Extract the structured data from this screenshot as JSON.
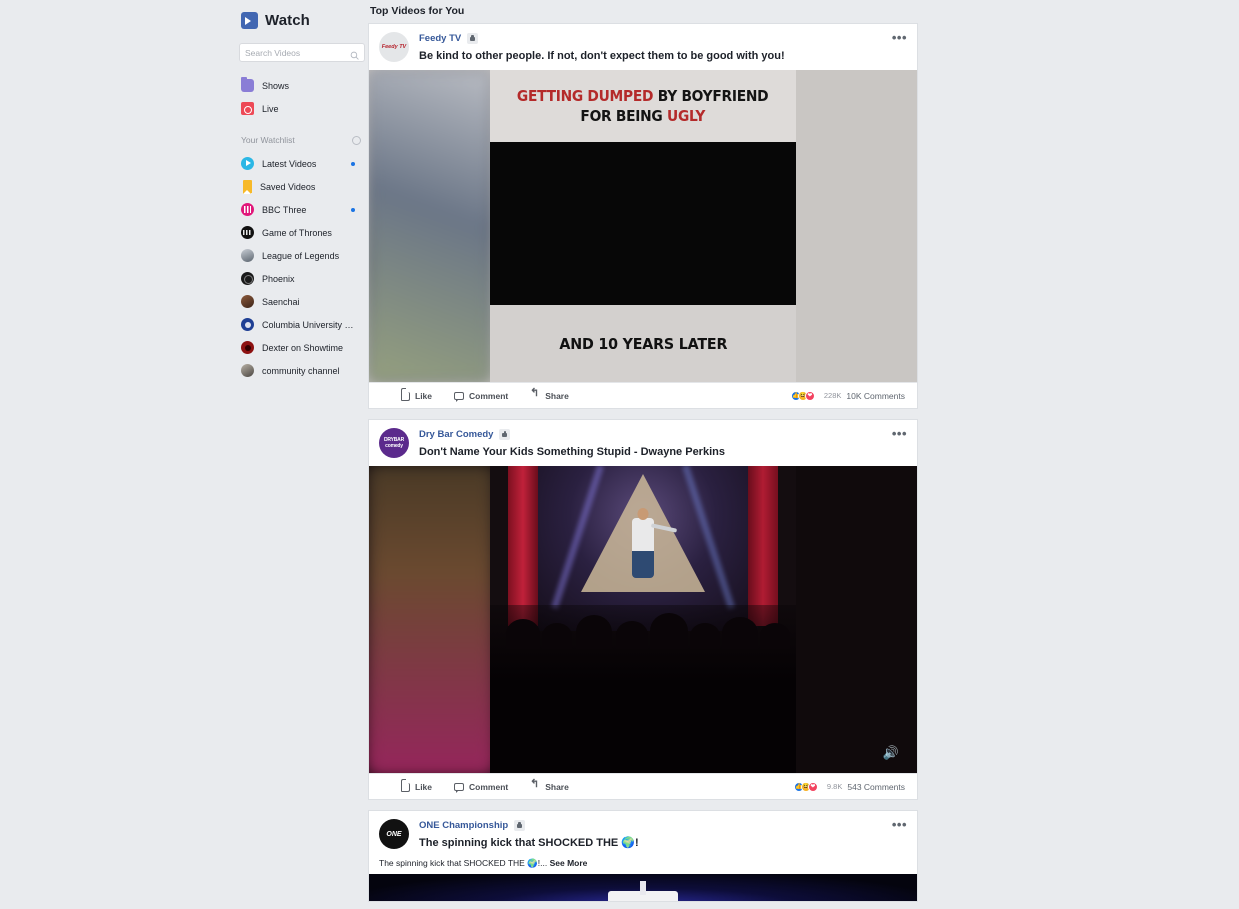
{
  "app": {
    "title": "Watch",
    "brand_icon": "watch-video-icon",
    "background": "#e9ebee"
  },
  "search": {
    "placeholder": "Search Videos",
    "value": "",
    "icon": "search-icon"
  },
  "sidebar": {
    "primary": [
      {
        "label": "Shows",
        "icon": "shows-icon"
      },
      {
        "label": "Live",
        "icon": "live-icon"
      }
    ],
    "watchlist_header": {
      "label": "Your Watchlist",
      "icon": "gear-icon"
    },
    "watchlist": [
      {
        "label": "Latest Videos",
        "icon": "latest-videos-icon",
        "unread": true
      },
      {
        "label": "Saved Videos",
        "icon": "bookmark-icon",
        "unread": false
      },
      {
        "label": "BBC Three",
        "icon": "bbc-three-avatar",
        "unread": true
      },
      {
        "label": "Game of Thrones",
        "icon": "game-of-thrones-avatar",
        "unread": false
      },
      {
        "label": "League of Legends",
        "icon": "league-of-legends-avatar",
        "unread": false
      },
      {
        "label": "Phoenix",
        "icon": "phoenix-avatar",
        "unread": false
      },
      {
        "label": "Saenchai",
        "icon": "saenchai-avatar",
        "unread": false
      },
      {
        "label": "Columbia University in ...",
        "icon": "columbia-university-avatar",
        "unread": false
      },
      {
        "label": "Dexter on Showtime",
        "icon": "dexter-avatar",
        "unread": false
      },
      {
        "label": "community channel",
        "icon": "community-channel-avatar",
        "unread": false
      }
    ]
  },
  "feed": {
    "heading": "Top Videos for You",
    "action_labels": {
      "like": "Like",
      "comment": "Comment",
      "share": "Share"
    },
    "posts": [
      {
        "page_name": "Feedy TV",
        "avatar_text": "Feedy TV",
        "badge": "video-badge-icon",
        "title": "Be kind to other people. If not, don't expect them to be good with you!",
        "subtitle": "",
        "see_more": "",
        "thumbnail": {
          "headline_line1_red": "GETTING DUMPED",
          "headline_line1_rest": " BY BOYFRIEND",
          "headline_line2_pre": "FOR BEING ",
          "headline_line2_red": "UGLY",
          "caption_bottom": "AND 10 YEARS LATER"
        },
        "reactions_count": "228K",
        "comments_count": "10K Comments",
        "menu": "more-options-icon"
      },
      {
        "page_name": "Dry Bar Comedy",
        "avatar_text": "DRYBAR comedy",
        "badge": "video-badge-icon",
        "title": "Don't Name Your Kids Something Stupid - Dwayne Perkins",
        "subtitle": "",
        "see_more": "",
        "thumbnail": {
          "muted_icon": "speaker-muted-icon"
        },
        "reactions_count": "9.8K",
        "comments_count": "543 Comments",
        "menu": "more-options-icon"
      },
      {
        "page_name": "ONE Championship",
        "avatar_text": "ONE",
        "badge": "video-badge-icon",
        "title": "The spinning kick that SHOCKED THE 🌍!",
        "subtitle": "The spinning kick that SHOCKED THE 🌍!...",
        "see_more": "See More",
        "thumbnail": {},
        "reactions_count": "",
        "comments_count": "",
        "menu": "more-options-icon"
      }
    ]
  },
  "colors": {
    "brand_blue": "#4267B2",
    "link_blue": "#365899",
    "like_blue": "#1b74e4",
    "haha_yellow": "#f7b125",
    "love_red": "#f3425f",
    "page_bg": "#e9ebee",
    "card_bg": "#ffffff"
  }
}
